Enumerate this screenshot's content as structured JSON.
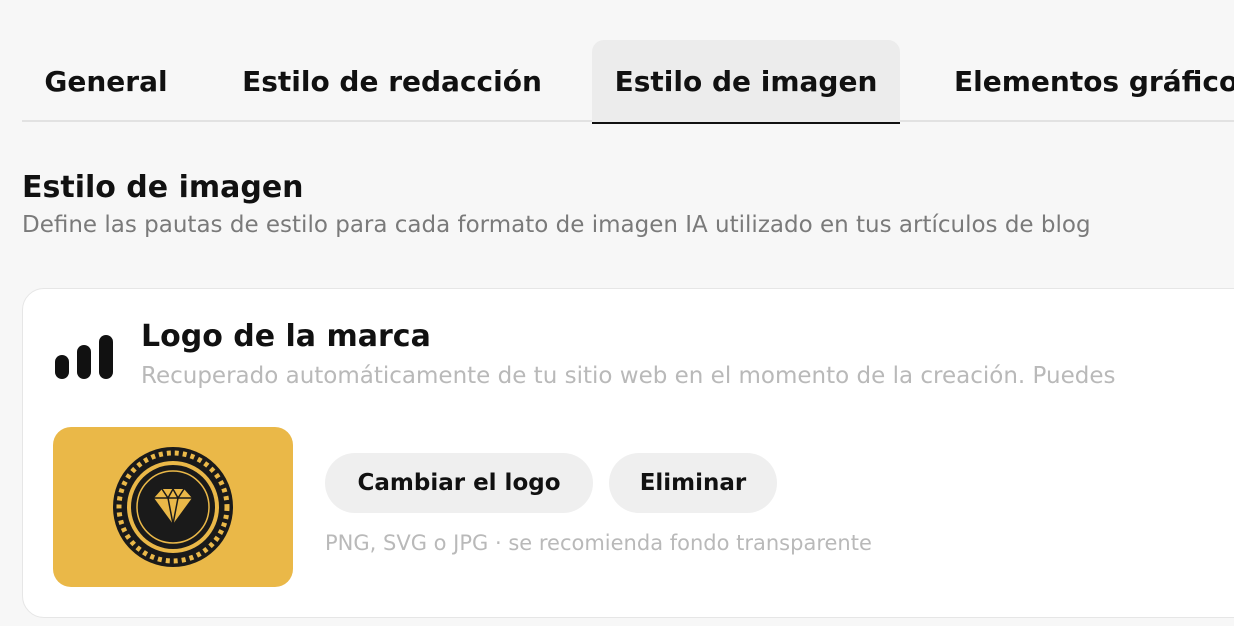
{
  "tabs": [
    {
      "label": "General",
      "active": false
    },
    {
      "label": "Estilo de redacción",
      "active": false
    },
    {
      "label": "Estilo de imagen",
      "active": true
    },
    {
      "label": "Elementos gráficos",
      "active": false
    }
  ],
  "section": {
    "title": "Estilo de imagen",
    "description": "Define las pautas de estilo para cada formato de imagen IA utilizado en tus artículos de blog"
  },
  "logo_card": {
    "icon": "bar-signal-icon",
    "title": "Logo de la marca",
    "subtitle": "Recuperado automáticamente de tu sitio web en el momento de la creación. Puedes",
    "logo_image": "diamond-emblem-logo",
    "change_button": "Cambiar el logo",
    "remove_button": "Eliminar",
    "hint": "PNG, SVG o JPG · se recomienda fondo transparente"
  },
  "colors": {
    "logo_background": "#eab848",
    "active_tab_background": "#ececec",
    "button_background": "#efefef"
  }
}
